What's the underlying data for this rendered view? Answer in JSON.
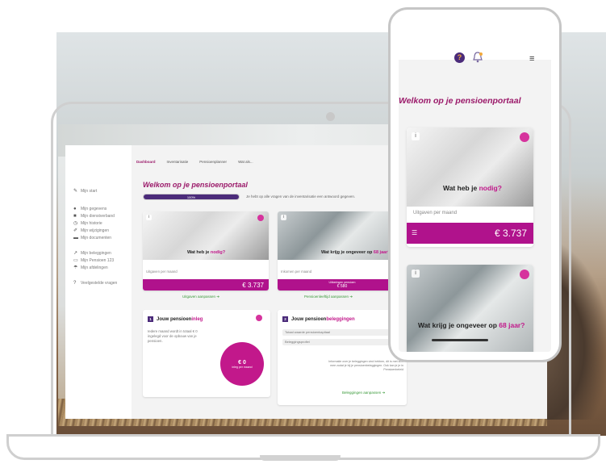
{
  "desktop": {
    "sidebar": {
      "items": [
        {
          "label": "Mijn start",
          "icon": "edit-icon"
        },
        {
          "label": "Mijn gegevens",
          "icon": "person-icon"
        },
        {
          "label": "Mijn dienstverband",
          "icon": "briefcase-icon"
        },
        {
          "label": "Mijn historie",
          "icon": "history-icon"
        },
        {
          "label": "Mijn wijzigingen",
          "icon": "pencil-icon"
        },
        {
          "label": "Mijn documenten",
          "icon": "folder-icon"
        },
        {
          "label": "Mijn beleggingen",
          "icon": "chart-icon"
        },
        {
          "label": "Mijn Pensioen 123",
          "icon": "card-icon"
        },
        {
          "label": "Mijn afdelingen",
          "icon": "umbrella-icon"
        },
        {
          "label": "Veelgestelde vragen",
          "icon": "question-icon"
        }
      ]
    },
    "topnav": [
      "Dashboard",
      "Inventarisatie",
      "Pensioenplanner",
      "Wat als..."
    ],
    "welcome": "Welkom op je pensioenportaal",
    "progress": {
      "label": "100%",
      "fraction": 1.0,
      "text": "Je hebt op alle vragen van de inventarisatie een antwoord gegeven."
    },
    "card1": {
      "heading_pre": "Wat heb je ",
      "heading_em": "nodig?",
      "sub": "Uitgaven per maand",
      "value": "€ 3.737",
      "link": "Uitgaven aanpassen ➜"
    },
    "card2": {
      "heading_pre": "Wat krijg je ongeveer op ",
      "heading_em": "68 jaar?",
      "sub": "Inkomen per maand",
      "small_label": "Uitkeringen pensioen",
      "value": "€ 580",
      "link": "Pensioenleeftijd aanpassen ➜"
    },
    "section1": {
      "num": "1",
      "title_pre": "Jouw pensioen",
      "title_em": "inleg",
      "text": "Iedere maand wordt in totaal € 0 ingelegd voor de opbouw van je pensioen.",
      "circle_value": "€ 0",
      "circle_label": "inleg per maand"
    },
    "section2": {
      "num": "2",
      "title_pre": "Jouw pensioen",
      "title_em": "beleggingen",
      "field1": "Totaal waarde pensioenkapitaal",
      "field2": "Beleggingsprofiel",
      "text": "Informatie over je beleggingen vind hebben, dit is met zich mee zodat je bij je pensioenbeleggingen. Ook kan je je in Pensioenbeleid",
      "link": "Beleggingen aanpassen ➜"
    }
  },
  "phone": {
    "welcome": "Welkom op je pensioenportaal",
    "help_label": "?",
    "card1": {
      "heading_pre": "Wat heb je ",
      "heading_em": "nodig?",
      "sub": "Uitgaven per maand",
      "value": "€ 3.737",
      "info": "i"
    },
    "card2": {
      "heading_pre": "Wat krijg je ongeveer op ",
      "heading_em": "68 jaar?",
      "info": "i"
    }
  },
  "colors": {
    "brand": "#9b1a6a",
    "accent": "#b0128c",
    "purple": "#4b2b7a",
    "green": "#3a9a3a"
  }
}
